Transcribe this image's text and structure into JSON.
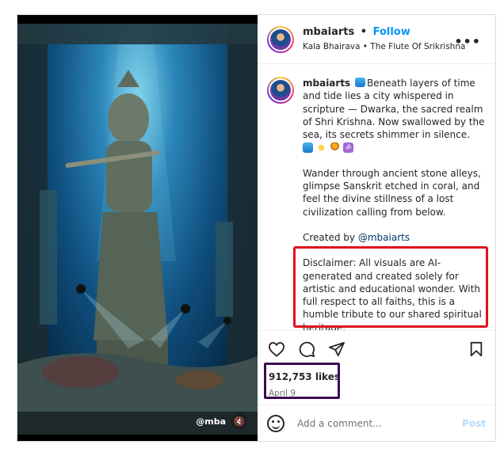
{
  "header": {
    "username": "mbaiarts",
    "separator": "•",
    "follow_label": "Follow",
    "audio_subtitle": "Kala Bhairava • The Flute Of Srikrishna",
    "more_label": "•••"
  },
  "media": {
    "watermark": "@mba",
    "mute_icon": "speaker-muted-icon"
  },
  "caption": {
    "username": "mbaiarts",
    "paragraph1": "Beneath layers of time and tide lies a city whispered in scripture — Dwarka, the sacred realm of Shri Krishna. Now swallowed by the sea, its secrets shimmer in silence.",
    "emojis": [
      "wave",
      "sparkles",
      "diya-lamp",
      "om"
    ],
    "om_glyph": "ॐ",
    "paragraph2": "Wander through ancient stone alleys, glimpse Sanskrit etched in coral, and feel the divine stillness of a lost civilization calling from below.",
    "created_by_prefix": "Created by",
    "created_by_handle": "@mbaiarts",
    "disclaimer": "Disclaimer: All visuals are AI-generated and created solely for artistic and educational wonder. With full respect to all faiths, this is a humble tribute to our shared spiritual heritage."
  },
  "actions": {
    "like_icon": "heart-icon",
    "comment_icon": "comment-icon",
    "share_icon": "send-icon",
    "save_icon": "bookmark-icon"
  },
  "stats": {
    "likes": "912,753 likes",
    "date": "April 9"
  },
  "comment": {
    "placeholder": "Add a comment...",
    "post_label": "Post"
  },
  "colors": {
    "follow": "#0095f6",
    "disclaimer_highlight": "#e0111c",
    "likes_highlight": "#3b0b52",
    "post_disabled": "#b3dbff"
  }
}
